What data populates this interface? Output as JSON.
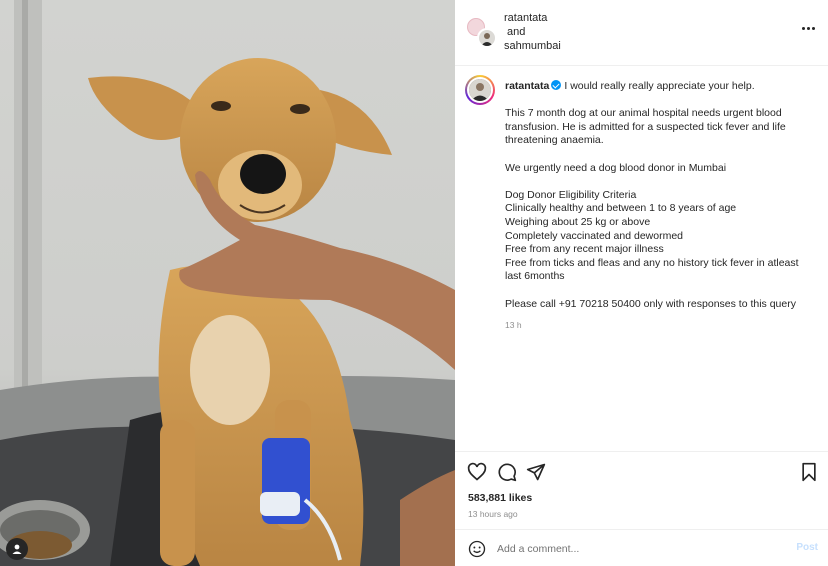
{
  "post": {
    "photo_alt": "dog",
    "user_tag_icon": "user-tag-icon"
  },
  "header": {
    "collab_user_1": "ratantata",
    "and_text": "and",
    "collab_user_2": "sahmumbai",
    "more_icon": "more-horizontal-icon"
  },
  "caption": {
    "username": "ratantata",
    "first_line": "I would really really appreciate your help.",
    "para1": [
      "This 7 month dog at our animal hospital needs urgent blood",
      "transfusion. He is admitted for a suspected tick fever and life",
      "threatening anaemia."
    ],
    "para2": "We urgently need a dog blood donor in Mumbai",
    "criteria": [
      "Dog Donor Eligibility Criteria",
      "Clinically healthy and between 1 to 8 years of age",
      "Weighing about 25 kg or above",
      "Completely vaccinated and dewormed",
      "Free from any recent major illness",
      "Free from ticks and fleas and any no history tick fever in atleast",
      "last 6months"
    ],
    "contact": "Please call +91 70218 50400 only with responses to this query",
    "time": "13 h"
  },
  "actions": {
    "likes": "583,881 likes",
    "ago": "13 hours ago"
  },
  "comment": {
    "placeholder": "Add a comment...",
    "post_label": "Post"
  },
  "colors": {
    "accent": "#0095f6",
    "post_disabled": "#c7e0fd"
  }
}
